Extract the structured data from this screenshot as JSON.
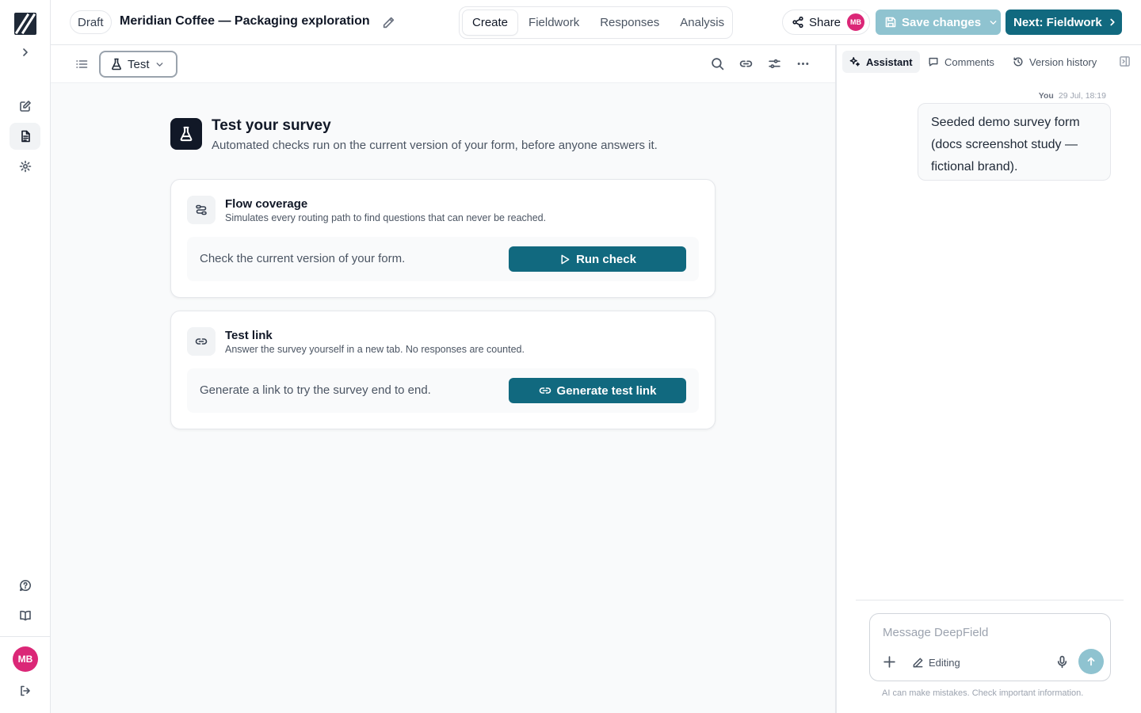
{
  "header": {
    "status_badge": "Draft",
    "title": "Meridian Coffee — Packaging exploration",
    "tabs": [
      {
        "label": "Create",
        "active": true
      },
      {
        "label": "Fieldwork",
        "active": false
      },
      {
        "label": "Responses",
        "active": false
      },
      {
        "label": "Analysis",
        "active": false
      }
    ],
    "share_label": "Share",
    "user_initials": "MB",
    "save_label": "Save changes",
    "next_label": "Next: Fieldwork"
  },
  "toolbar": {
    "mode_label": "Test"
  },
  "main": {
    "title": "Test your survey",
    "subtitle": "Automated checks run on the current version of your form, before anyone answers it.",
    "cards": [
      {
        "title": "Flow coverage",
        "description": "Simulates every routing path to find questions that can never be reached.",
        "row_text": "Check the current version of your form.",
        "button_label": "Run check"
      },
      {
        "title": "Test link",
        "description": "Answer the survey yourself in a new tab. No responses are counted.",
        "row_text": "Generate a link to try the survey end to end.",
        "button_label": "Generate test link"
      }
    ]
  },
  "panel": {
    "tabs": [
      {
        "label": "Assistant",
        "active": true
      },
      {
        "label": "Comments",
        "active": false
      },
      {
        "label": "Version history",
        "active": false
      }
    ],
    "message": {
      "author": "You",
      "timestamp": "29 Jul, 18:19",
      "text": "Seeded demo survey form (docs screenshot study — fictional brand)."
    },
    "composer": {
      "placeholder": "Message DeepField",
      "mode_label": "Editing"
    },
    "disclaimer": "AI can make mistakes. Check important information."
  },
  "rail": {
    "user_initials": "MB"
  },
  "colors": {
    "primary": "#11697f",
    "primary_disabled": "#8fc3d0",
    "avatar": "#db2777",
    "dark": "#111827"
  }
}
